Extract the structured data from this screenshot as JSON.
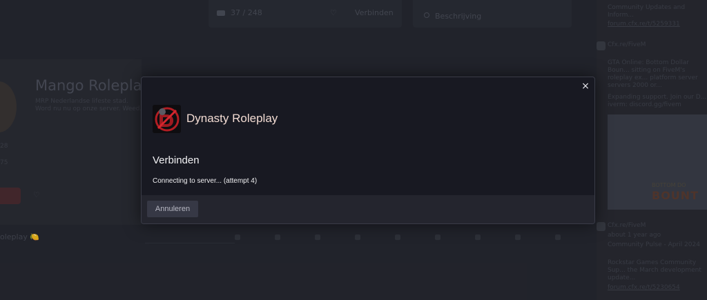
{
  "background": {
    "top_card": {
      "players": "37 / 248",
      "connect_label": "Verbinden"
    },
    "top_card2": {
      "description_label": "Beschrijving"
    },
    "server": {
      "title": "Mango Roleplay",
      "description": "MRP Nederlandse lifeste stad. Word nu nu op onze server. Weed. 3rd",
      "stat1": "28",
      "stat2": "75",
      "subheading": "oleplay 🍋"
    },
    "feed": {
      "item1_text": "Community Updates and Inform...",
      "item1_link": "forum.cfx.re/t/5259331",
      "item2_author": "Cfx.re/FiveM",
      "item2_text": "GTA Online: Bottom Dollar Boun... sitting on FiveM's roleplay ex... platform server servers 2000 or...",
      "item2_text2": "Expanding support. Join our D... iverm: discord.gg/fivem",
      "image_banner_top": "BOTTOM DO",
      "image_banner": "BOUNT",
      "item3_author": "Cfx.re/FiveM",
      "item3_meta": "about 1 year ago",
      "item3_title": "Community Pulse - April 2024",
      "item3_text": "Rockstar Games Community Sup... the March development update...",
      "item3_link": "forum.cfx.re/t/5230654"
    }
  },
  "modal": {
    "server_name": "Dynasty Roleplay",
    "title": "Verbinden",
    "status": "Connecting to server... (attempt 4)",
    "cancel_label": "Annuleren",
    "close_icon": "×",
    "colors": {
      "server_name": "#f3dcd3",
      "footer": "#24252e",
      "panel": "#181922"
    }
  }
}
